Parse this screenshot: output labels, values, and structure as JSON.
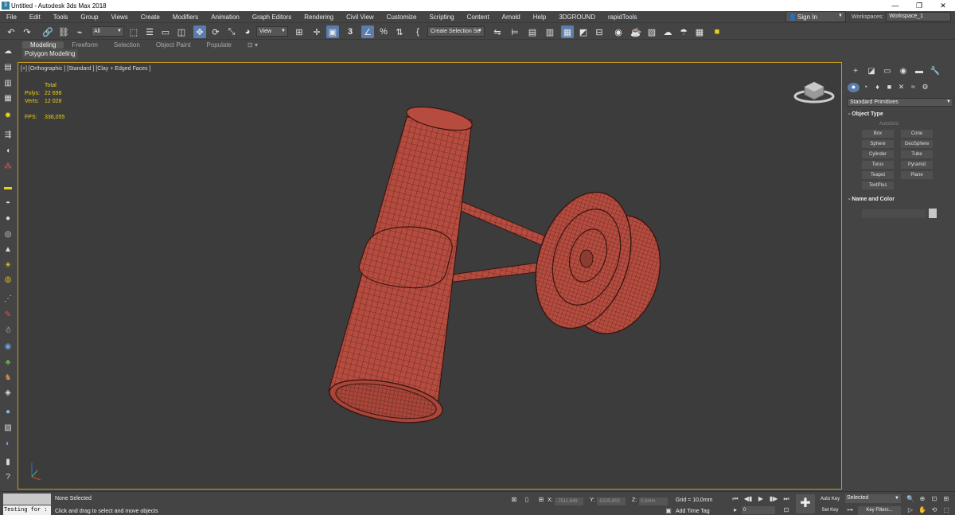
{
  "window": {
    "title": "Untitled - Autodesk 3ds Max 2018",
    "app_icon": "3ds-max-icon",
    "controls": [
      "—",
      "❐",
      "✕"
    ]
  },
  "menu": {
    "items": [
      "File",
      "Edit",
      "Tools",
      "Group",
      "Views",
      "Create",
      "Modifiers",
      "Animation",
      "Graph Editors",
      "Rendering",
      "Civil View",
      "Customize",
      "Scripting",
      "Content",
      "Arnold",
      "Help",
      "3DGROUND",
      "rapidTools"
    ],
    "sign_in": "Sign In",
    "workspaces_label": "Workspaces:",
    "workspace_value": "Workspace_1"
  },
  "toolbar": {
    "selection_filter": "All",
    "ref_coord": "View",
    "selection_set": "Create Selection Se",
    "snap_value": "3"
  },
  "ribbon": {
    "tabs": [
      "Modeling",
      "Freeform",
      "Selection",
      "Object Paint",
      "Populate"
    ],
    "active_tab": "Modeling",
    "sub_label": "Polygon Modeling"
  },
  "viewport": {
    "label": "[+] [Orthographic ] [Standard ] [Clay + Edged Faces ]",
    "stats": {
      "total_label": "Total",
      "polys_label": "Polys:",
      "polys_value": "22 698",
      "verts_label": "Verts:",
      "verts_value": "12 028",
      "fps_label": "FPS:",
      "fps_value": "336,055"
    },
    "object_color": "#b54c3f",
    "wire_color": "#3b1511"
  },
  "command_panel": {
    "category": "Standard Primitives",
    "object_type_title": "Object Type",
    "autogrid_label": "AutoGrid",
    "buttons": [
      "Box",
      "Cone",
      "Sphere",
      "GeoSphere",
      "Cylinder",
      "Tube",
      "Torus",
      "Pyramid",
      "Teapot",
      "Plane",
      "TextPlus"
    ],
    "name_color_title": "Name and Color"
  },
  "status": {
    "selection": "None Selected",
    "prompt": "Click and drag to select and move objects",
    "maxscript": "Testing for :",
    "x_label": "X:",
    "x_value": "-7511,648",
    "y_label": "Y:",
    "y_value": "-5225,802",
    "z_label": "Z:",
    "z_value": "0,0mm",
    "grid": "Grid = 10,0mm",
    "add_time_tag": "Add Time Tag",
    "auto_key": "Auto Key",
    "set_key": "Set Key",
    "key_mode": "Selected",
    "key_filters": "Key Filters...",
    "frame": "0"
  }
}
